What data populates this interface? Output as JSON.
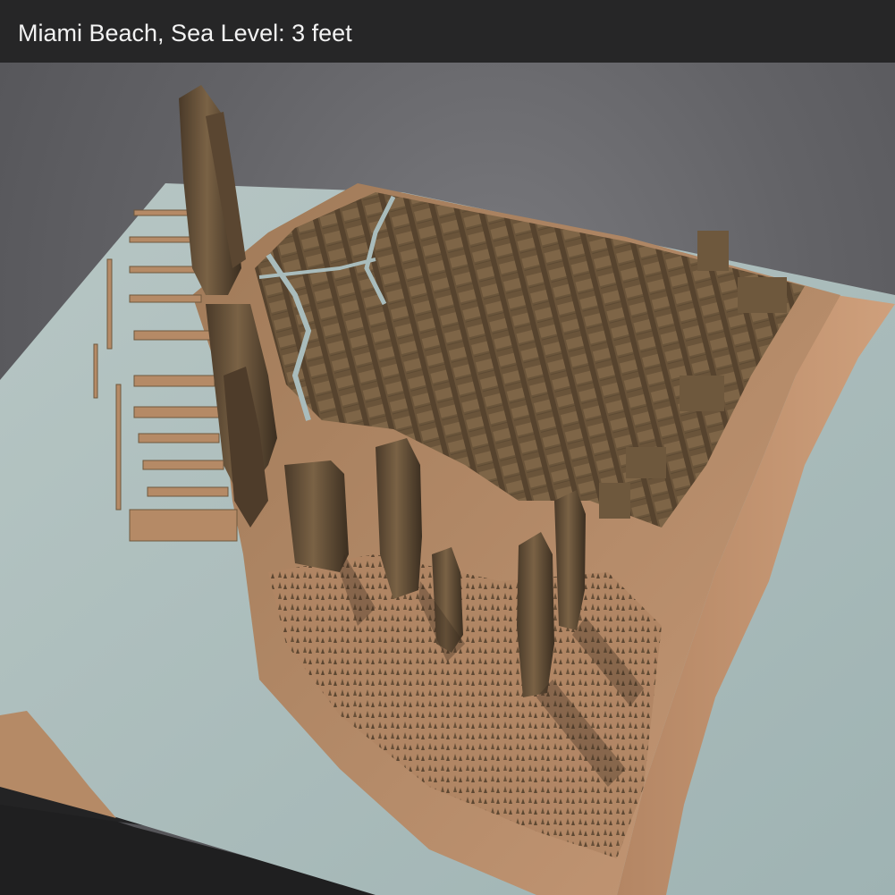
{
  "header": {
    "title": "Miami Beach, Sea Level: 3 feet"
  },
  "scene": {
    "description_colors": {
      "water": "#a9bcbc",
      "land": "#b58a66",
      "building": "#6e583d",
      "building_dark": "#3e3022",
      "slab_edge": "#1e1e1f",
      "background": "#5e5e62"
    }
  }
}
